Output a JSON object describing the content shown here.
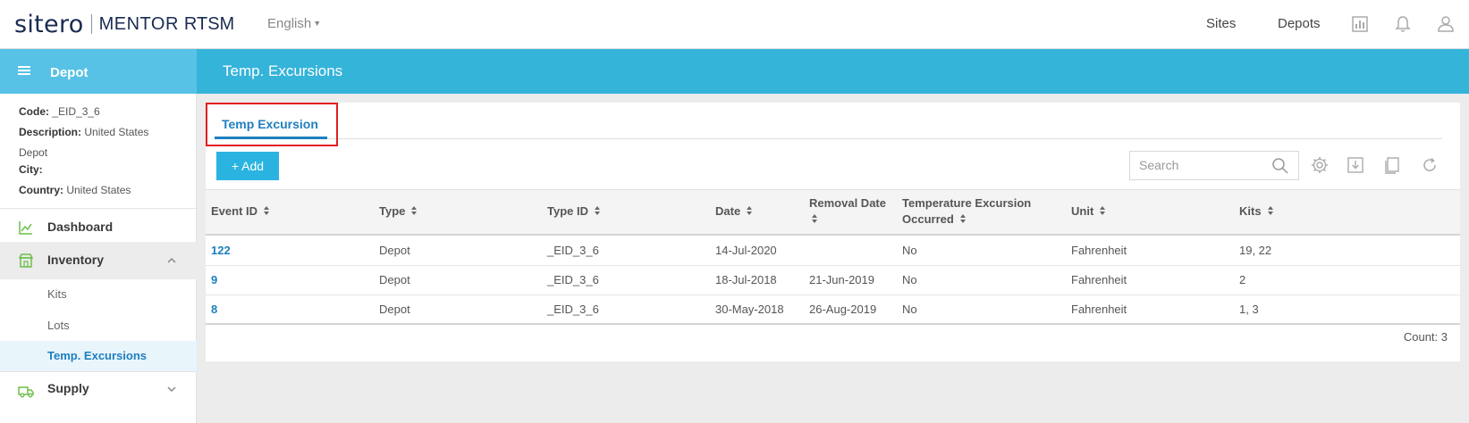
{
  "header": {
    "logo_brand": "sitero",
    "logo_product": "MENTOR",
    "logo_suffix": "RTSM",
    "language": "English",
    "nav_sites": "Sites",
    "nav_depots": "Depots"
  },
  "page": {
    "title": "Temp. Excursions"
  },
  "sidebar": {
    "title": "Depot",
    "code_label": "Code:",
    "code_value": "_EID_3_6",
    "description_label": "Description:",
    "description_value_line1": "United States",
    "description_value_line2": "Depot",
    "city_label": "City:",
    "country_label": "Country:",
    "country_value": "United States",
    "items": [
      {
        "label": "Dashboard",
        "icon": "chart-line-icon"
      },
      {
        "label": "Inventory",
        "icon": "store-icon"
      },
      {
        "label": "Kits"
      },
      {
        "label": "Lots"
      },
      {
        "label": "Temp. Excursions"
      },
      {
        "label": "Supply",
        "icon": "truck-icon"
      }
    ]
  },
  "tabs": [
    {
      "label": "Temp Excursion"
    }
  ],
  "toolbar": {
    "add_label": "+ Add",
    "search_placeholder": "Search"
  },
  "table": {
    "headers": [
      "Event ID",
      "Type",
      "Type ID",
      "Date",
      "Removal Date",
      "Temperature Excursion",
      "Occurred",
      "Unit",
      "Kits"
    ],
    "rows": [
      {
        "event_id": "122",
        "type": "Depot",
        "type_id": "_EID_3_6",
        "date": "14-Jul-2020",
        "removal_date": "",
        "occurred": "No",
        "unit": "Fahrenheit",
        "kits": "19, 22"
      },
      {
        "event_id": "9",
        "type": "Depot",
        "type_id": "_EID_3_6",
        "date": "18-Jul-2018",
        "removal_date": "21-Jun-2019",
        "occurred": "No",
        "unit": "Fahrenheit",
        "kits": "2"
      },
      {
        "event_id": "8",
        "type": "Depot",
        "type_id": "_EID_3_6",
        "date": "30-May-2018",
        "removal_date": "26-Aug-2019",
        "occurred": "No",
        "unit": "Fahrenheit",
        "kits": "1, 3"
      }
    ],
    "count_text": "Count: 3"
  },
  "colors": {
    "accent": "#35b4da",
    "sidebar_head": "#57c2e5",
    "link": "#1e7fbf",
    "highlight": "#e31d1d",
    "active_bg": "#e8f5fb"
  }
}
